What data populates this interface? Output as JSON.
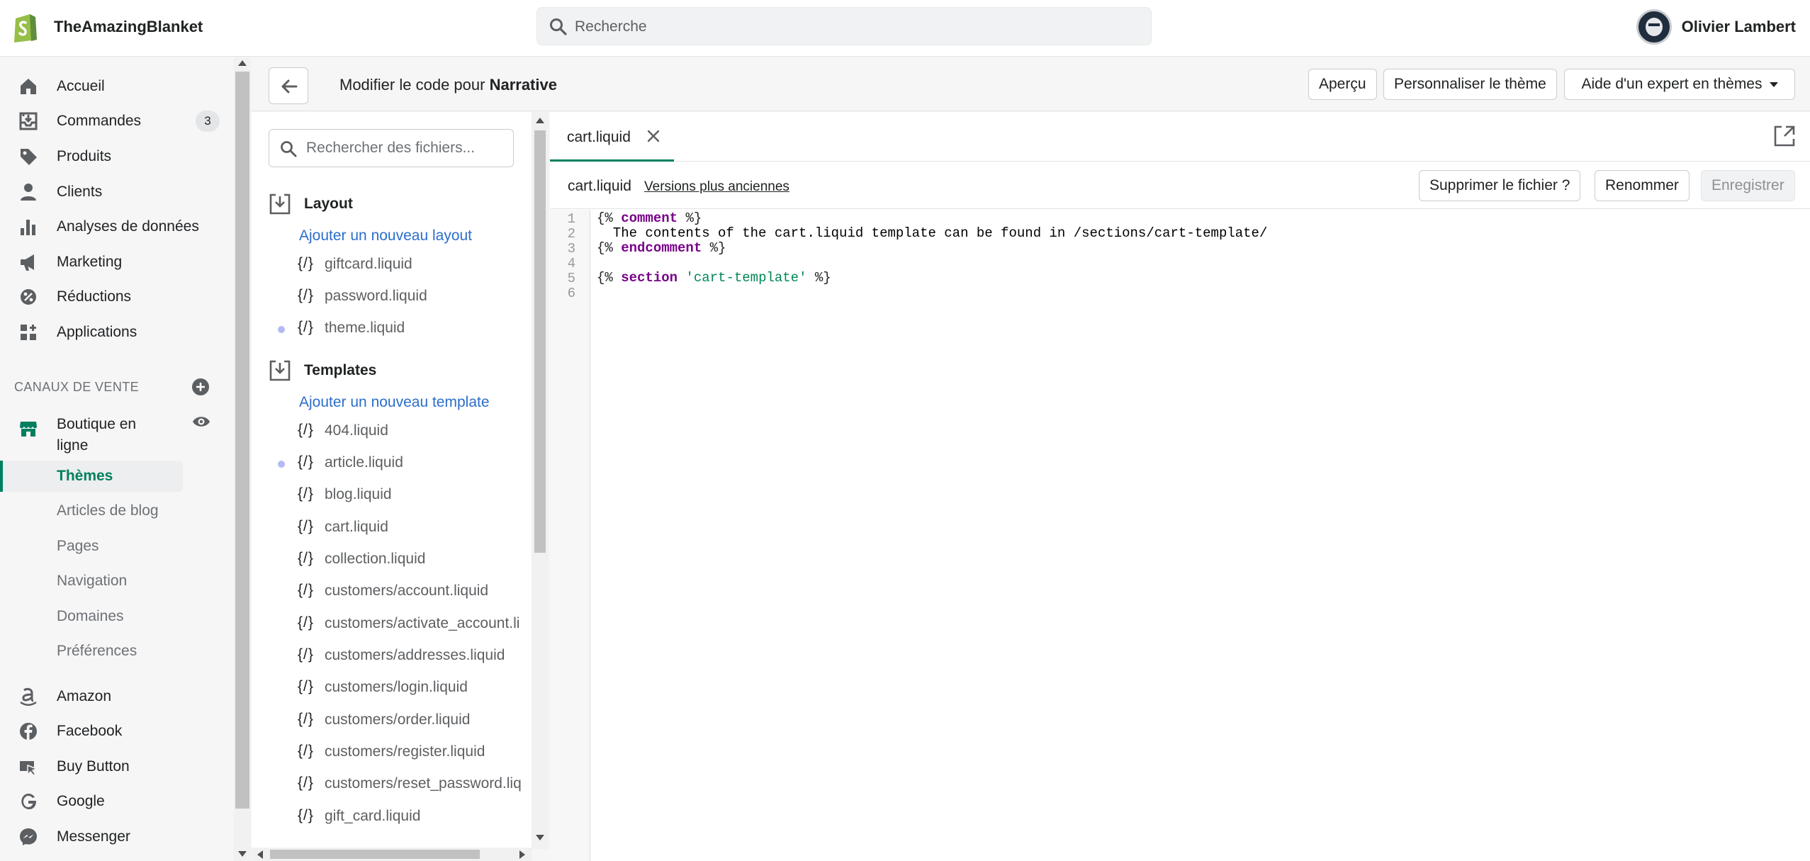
{
  "topbar": {
    "store_name": "TheAmazingBlanket",
    "search_placeholder": "Recherche",
    "user_name": "Olivier Lambert"
  },
  "sidenav": {
    "items": [
      {
        "label": "Accueil",
        "icon": "home-icon"
      },
      {
        "label": "Commandes",
        "icon": "orders-icon",
        "badge": "3"
      },
      {
        "label": "Produits",
        "icon": "tag-icon"
      },
      {
        "label": "Clients",
        "icon": "person-icon"
      },
      {
        "label": "Analyses de données",
        "icon": "analytics-icon"
      },
      {
        "label": "Marketing",
        "icon": "megaphone-icon"
      },
      {
        "label": "Réductions",
        "icon": "discount-icon"
      },
      {
        "label": "Applications",
        "icon": "apps-icon"
      }
    ],
    "sales_channels_title": "CANAUX DE VENTE",
    "online_store": "Boutique en ligne",
    "online_store_line1": "Boutique en",
    "online_store_line2": "ligne",
    "sub_items": [
      "Thèmes",
      "Articles de blog",
      "Pages",
      "Navigation",
      "Domaines",
      "Préférences"
    ],
    "channels": [
      {
        "label": "Amazon",
        "icon": "amazon-icon"
      },
      {
        "label": "Facebook",
        "icon": "facebook-icon"
      },
      {
        "label": "Buy Button",
        "icon": "buy-button-icon"
      },
      {
        "label": "Google",
        "icon": "google-icon"
      },
      {
        "label": "Messenger",
        "icon": "messenger-icon"
      }
    ]
  },
  "editor_header": {
    "title_prefix": "Modifier le code pour",
    "theme_name": "Narrative",
    "preview_label": "Aperçu",
    "customize_label": "Personnaliser le thème",
    "expert_label": "Aide d'un expert en thèmes"
  },
  "files": {
    "search_placeholder": "Rechercher des fichiers...",
    "layout_folder": "Layout",
    "add_layout": "Ajouter un nouveau layout",
    "layout_files": [
      {
        "name": "giftcard.liquid",
        "modified": false
      },
      {
        "name": "password.liquid",
        "modified": false
      },
      {
        "name": "theme.liquid",
        "modified": true
      }
    ],
    "templates_folder": "Templates",
    "add_template": "Ajouter un nouveau template",
    "template_files": [
      {
        "name": "404.liquid",
        "modified": false
      },
      {
        "name": "article.liquid",
        "modified": true
      },
      {
        "name": "blog.liquid",
        "modified": false
      },
      {
        "name": "cart.liquid",
        "modified": false
      },
      {
        "name": "collection.liquid",
        "modified": false
      },
      {
        "name": "customers/account.liquid",
        "modified": false
      },
      {
        "name": "customers/activate_account.li",
        "modified": false
      },
      {
        "name": "customers/addresses.liquid",
        "modified": false
      },
      {
        "name": "customers/login.liquid",
        "modified": false
      },
      {
        "name": "customers/order.liquid",
        "modified": false
      },
      {
        "name": "customers/register.liquid",
        "modified": false
      },
      {
        "name": "customers/reset_password.liq",
        "modified": false
      },
      {
        "name": "gift_card.liquid",
        "modified": false
      }
    ],
    "tag_glyph": "{/}"
  },
  "editor": {
    "tab_label": "cart.liquid",
    "file_name": "cart.liquid",
    "versions_link": "Versions plus anciennes",
    "delete_label": "Supprimer le fichier ?",
    "rename_label": "Renommer",
    "save_label": "Enregistrer",
    "line_numbers": [
      "1",
      "2",
      "3",
      "4",
      "5",
      "6"
    ],
    "code": {
      "l1_open": "{%",
      "l1_kw": "comment",
      "l1_close": "%}",
      "l2": "  The contents of the cart.liquid template can be found in /sections/cart-template/",
      "l3_open": "{%",
      "l3_kw": "endcomment",
      "l3_close": "%}",
      "l5_open": "{%",
      "l5_kw": "section",
      "l5_str": "'cart-template'",
      "l5_close": "%}"
    }
  },
  "colors": {
    "accent_green": "#008060",
    "link_blue": "#2c6ecb",
    "modified_dot": "#b4b9f3",
    "keyword_purple": "#770088",
    "string_green": "#008855"
  }
}
